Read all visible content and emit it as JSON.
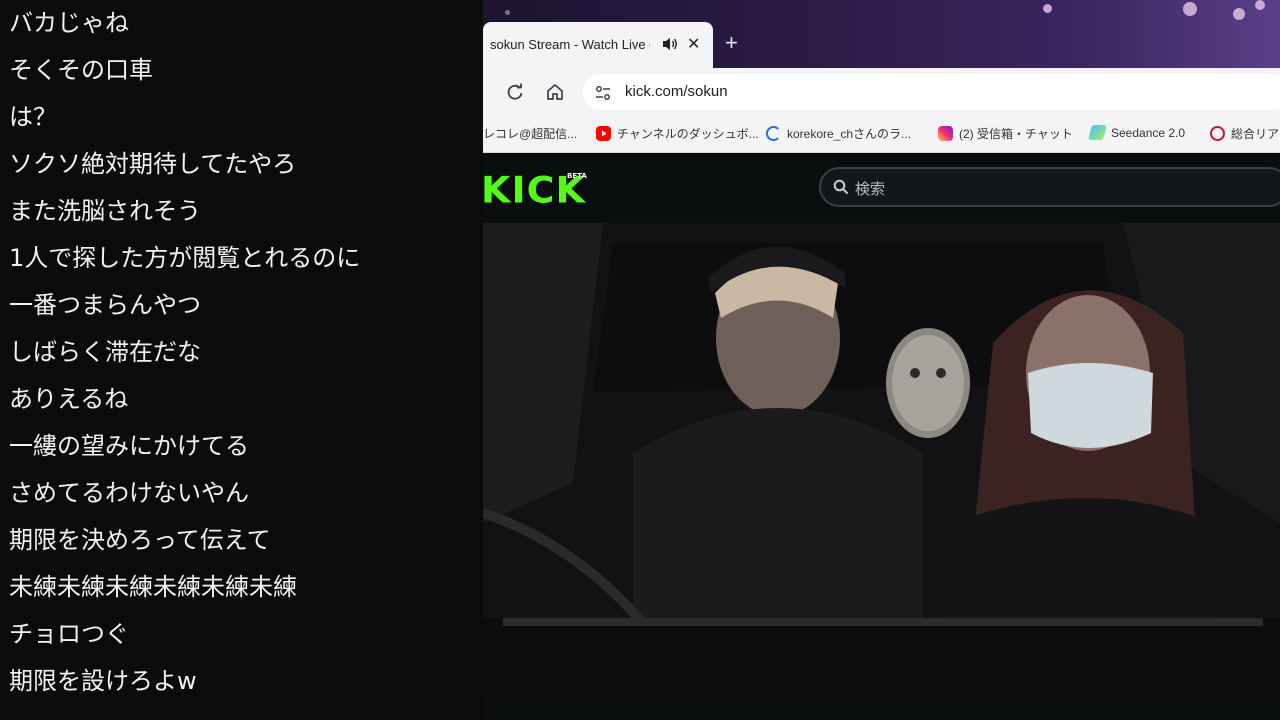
{
  "chat": {
    "lines": [
      "バカじゃね",
      "そくその口車",
      "は？",
      "ソクソ絶対期待してたやろ",
      "また洗脳されそう",
      "1人で探した方が閲覧とれるのに",
      "一番つまらんやつ",
      "しばらく滞在だな",
      "ありえるね",
      "一縷の望みにかけてる",
      "さめてるわけないやん",
      "期限を決めろって伝えて",
      "未練未練未練未練未練未練",
      "チョロつぐ",
      "期限を設けろよw"
    ]
  },
  "browser": {
    "tab": {
      "title": "sokun Stream - Watch Live o",
      "audio_icon": "speaker-icon",
      "close_label": "✕"
    },
    "new_tab_label": "+",
    "toolbar": {
      "reload_icon": "reload-icon",
      "home_icon": "home-icon",
      "site_info_icon": "tune-icon",
      "url": "kick.com/sokun"
    },
    "bookmarks": [
      {
        "label": "レコレ@超配信...",
        "icon": "page-icon",
        "color": "#9aa0a6"
      },
      {
        "label": "チャンネルのダッシュボ...",
        "icon": "youtube-icon",
        "color": "#ff0000"
      },
      {
        "label": "korekore_chさんのラ...",
        "icon": "loading-icon",
        "color": "#1a73e8"
      },
      {
        "label": "(2) 受信箱・チャット",
        "icon": "instagram-icon",
        "color": "#d62976"
      },
      {
        "label": "Seedance 2.0",
        "icon": "seedance-icon",
        "color": "#4ac1f7"
      },
      {
        "label": "総合リア",
        "icon": "crown-icon",
        "color": "#c8102e"
      }
    ]
  },
  "kick": {
    "logo_text": "KICK",
    "beta_badge": "BETA",
    "search_placeholder": "検索",
    "brand_color": "#53fc18"
  }
}
